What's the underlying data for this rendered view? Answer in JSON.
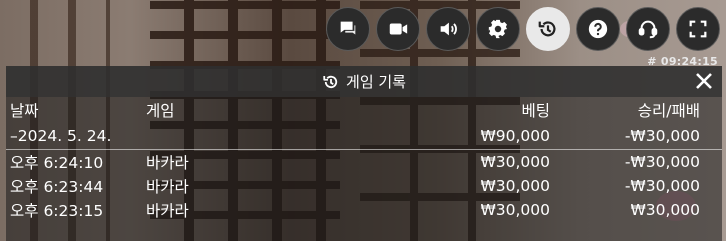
{
  "toolbar": {
    "buttons": [
      {
        "icon": "chat-icon"
      },
      {
        "icon": "video-icon"
      },
      {
        "icon": "volume-icon"
      },
      {
        "icon": "gear-icon"
      },
      {
        "icon": "history-icon",
        "active": true
      },
      {
        "icon": "help-icon"
      },
      {
        "icon": "headset-icon"
      },
      {
        "icon": "fullscreen-icon"
      }
    ]
  },
  "clock": "# 09:24:15",
  "history": {
    "title": "게임 기록",
    "columns": {
      "date": "날짜",
      "game": "게임",
      "bet": "베팅",
      "result": "승리/패배"
    },
    "summary": {
      "date": "–2024. 5. 24.",
      "bet": "₩90,000",
      "result": "-₩30,000"
    },
    "rows": [
      {
        "time": "오후 6:24:10",
        "game": "바카라",
        "bet": "₩30,000",
        "result": "-₩30,000"
      },
      {
        "time": "오후 6:23:44",
        "game": "바카라",
        "bet": "₩30,000",
        "result": "-₩30,000"
      },
      {
        "time": "오후 6:23:15",
        "game": "바카라",
        "bet": "₩30,000",
        "result": "₩30,000"
      }
    ]
  }
}
